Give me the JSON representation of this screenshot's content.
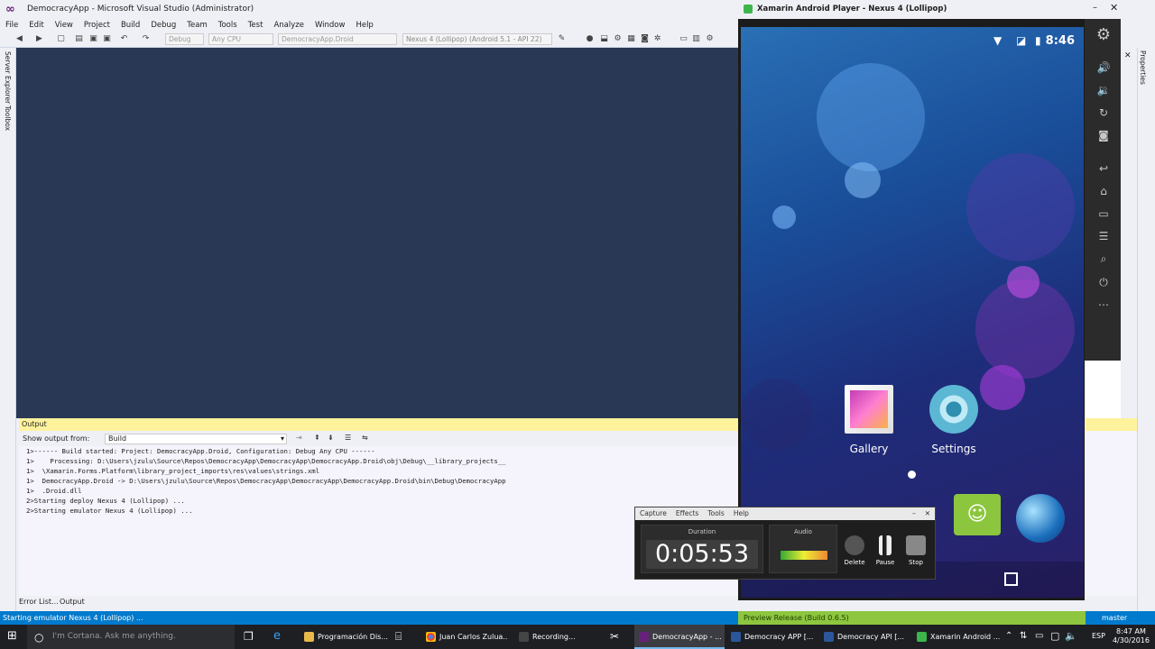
{
  "vs": {
    "title": "DemocracyApp - Microsoft Visual Studio (Administrator)",
    "menu": [
      "File",
      "Edit",
      "View",
      "Project",
      "Build",
      "Debug",
      "Team",
      "Tools",
      "Test",
      "Analyze",
      "Window",
      "Help"
    ],
    "toolbar": {
      "config": "Debug",
      "platform": "Any CPU",
      "project": "DemocracyApp.Droid",
      "device": "Nexus 4 (Lollipop) (Android 5.1 - API 22)"
    },
    "left_tabs": [
      "Server Explorer",
      "Toolbox"
    ],
    "output": {
      "title": "Output",
      "show_from_label": "Show output from:",
      "show_from_value": "Build",
      "lines": [
        "1>------ Build started: Project: DemocracyApp.Droid, Configuration: Debug Any CPU ------",
        "1>    Processing: D:\\Users\\jzulu\\Source\\Repos\\DemocracyApp\\DemocracyApp\\DemocracyApp.Droid\\obj\\Debug\\__library_projects__",
        "1>  \\Xamarin.Forms.Platform\\library_project_imports\\res\\values\\strings.xml",
        "1>  DemocracyApp.Droid -> D:\\Users\\jzulu\\Source\\Repos\\DemocracyApp\\DemocracyApp\\DemocracyApp.Droid\\bin\\Debug\\DemocracyApp",
        "1>  .Droid.dll",
        "2>Starting deploy Nexus 4 (Lollipop) ...",
        "2>Starting emulator Nexus 4 (Lollipop) ..."
      ]
    },
    "bottom_tabs": [
      "Error List...",
      "Output"
    ],
    "status": "Starting emulator Nexus 4 (Lollipop) ...",
    "branch": "master",
    "properties_tab": "Properties"
  },
  "player": {
    "title": "Xamarin Android Player - Nexus 4 (Lollipop)",
    "time": "8:46",
    "apps": [
      {
        "label": "Gallery"
      },
      {
        "label": "Settings"
      }
    ],
    "status_bar": "Preview Release (Build 0.6.5)"
  },
  "recorder": {
    "menu": [
      "Capture",
      "Effects",
      "Tools",
      "Help"
    ],
    "duration_label": "Duration",
    "duration": "0:05:53",
    "audio_label": "Audio",
    "buttons": [
      "Delete",
      "Pause",
      "Stop"
    ]
  },
  "taskbar": {
    "cortana": "I'm Cortana. Ask me anything.",
    "apps": [
      "Programación Dis...",
      "Juan Carlos Zulua...",
      "Recording...",
      "DemocracyApp - ...",
      "Democracy APP [...",
      "Democracy API [...",
      "Xamarin Android ..."
    ],
    "lang": "ESP",
    "time": "8:47 AM",
    "date": "4/30/2016"
  },
  "colors": {
    "accent": "#007acc",
    "editor": "#293955",
    "output_header": "#fff29d",
    "player_status": "#8ec63f"
  }
}
